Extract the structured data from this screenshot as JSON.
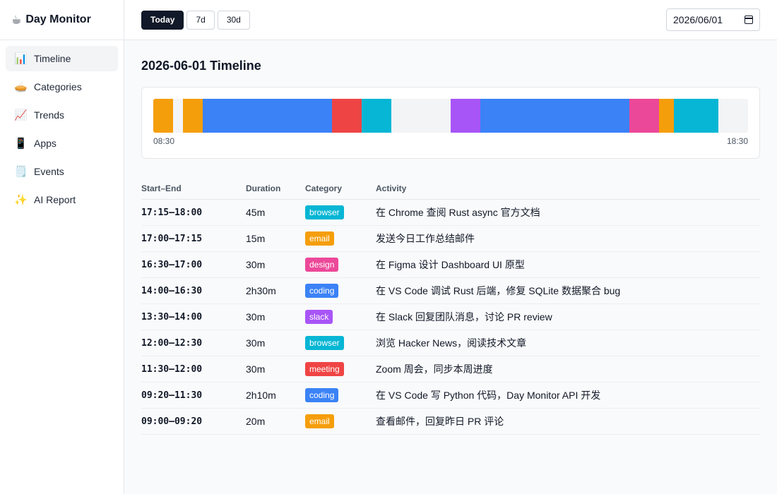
{
  "app": {
    "brand_icon": "☕",
    "brand_title": "Day Monitor"
  },
  "sidebar": {
    "items": [
      {
        "icon": "📊",
        "label": "Timeline",
        "icon_name": "bar-chart-icon",
        "active": true
      },
      {
        "icon": "🥧",
        "label": "Categories",
        "icon_name": "pie-icon",
        "active": false
      },
      {
        "icon": "📈",
        "label": "Trends",
        "icon_name": "trend-up-icon",
        "active": false
      },
      {
        "icon": "📱",
        "label": "Apps",
        "icon_name": "phone-icon",
        "active": false
      },
      {
        "icon": "🗒️",
        "label": "Events",
        "icon_name": "notepad-icon",
        "active": false
      },
      {
        "icon": "✨",
        "label": "AI Report",
        "icon_name": "sparkles-icon",
        "active": false
      }
    ]
  },
  "topbar": {
    "ranges": [
      {
        "label": "Today",
        "active": true
      },
      {
        "label": "7d",
        "active": false
      },
      {
        "label": "30d",
        "active": false
      }
    ],
    "date_value": "2026/06/01",
    "date_icon": "calendar-icon"
  },
  "main": {
    "title": "2026-06-01 Timeline",
    "timeline": {
      "start_label": "08:30",
      "end_label": "18:30",
      "day_start_minutes": 510,
      "day_end_minutes": 1110,
      "segments": [
        {
          "start": "08:30",
          "end": "08:50",
          "category": "email"
        },
        {
          "start": "09:00",
          "end": "09:20",
          "category": "email"
        },
        {
          "start": "09:20",
          "end": "11:30",
          "category": "coding"
        },
        {
          "start": "11:30",
          "end": "12:00",
          "category": "meeting"
        },
        {
          "start": "12:00",
          "end": "12:30",
          "category": "browser"
        },
        {
          "start": "13:30",
          "end": "14:00",
          "category": "slack"
        },
        {
          "start": "14:00",
          "end": "16:30",
          "category": "coding"
        },
        {
          "start": "16:30",
          "end": "17:00",
          "category": "design"
        },
        {
          "start": "17:00",
          "end": "17:15",
          "category": "email"
        },
        {
          "start": "17:15",
          "end": "18:00",
          "category": "browser"
        }
      ]
    },
    "category_colors": {
      "browser": "#06b6d4",
      "email": "#f59e0b",
      "design": "#ec4899",
      "coding": "#3b82f6",
      "slack": "#a855f7",
      "meeting": "#ef4444"
    },
    "table": {
      "headers": [
        "Start–End",
        "Duration",
        "Category",
        "Activity"
      ],
      "rows": [
        {
          "range": "17:15–18:00",
          "duration": "45m",
          "category": "browser",
          "activity": "在 Chrome 查阅 Rust async 官方文档"
        },
        {
          "range": "17:00–17:15",
          "duration": "15m",
          "category": "email",
          "activity": "发送今日工作总结邮件"
        },
        {
          "range": "16:30–17:00",
          "duration": "30m",
          "category": "design",
          "activity": "在 Figma 设计 Dashboard UI 原型"
        },
        {
          "range": "14:00–16:30",
          "duration": "2h30m",
          "category": "coding",
          "activity": "在 VS Code 调试 Rust 后端，修复 SQLite 数据聚合 bug"
        },
        {
          "range": "13:30–14:00",
          "duration": "30m",
          "category": "slack",
          "activity": "在 Slack 回复团队消息，讨论 PR review"
        },
        {
          "range": "12:00–12:30",
          "duration": "30m",
          "category": "browser",
          "activity": "浏览 Hacker News，阅读技术文章"
        },
        {
          "range": "11:30–12:00",
          "duration": "30m",
          "category": "meeting",
          "activity": "Zoom 周会，同步本周进度"
        },
        {
          "range": "09:20–11:30",
          "duration": "2h10m",
          "category": "coding",
          "activity": "在 VS Code 写 Python 代码，Day Monitor API 开发"
        },
        {
          "range": "09:00–09:20",
          "duration": "20m",
          "category": "email",
          "activity": "查看邮件，回复昨日 PR 评论"
        }
      ]
    }
  }
}
